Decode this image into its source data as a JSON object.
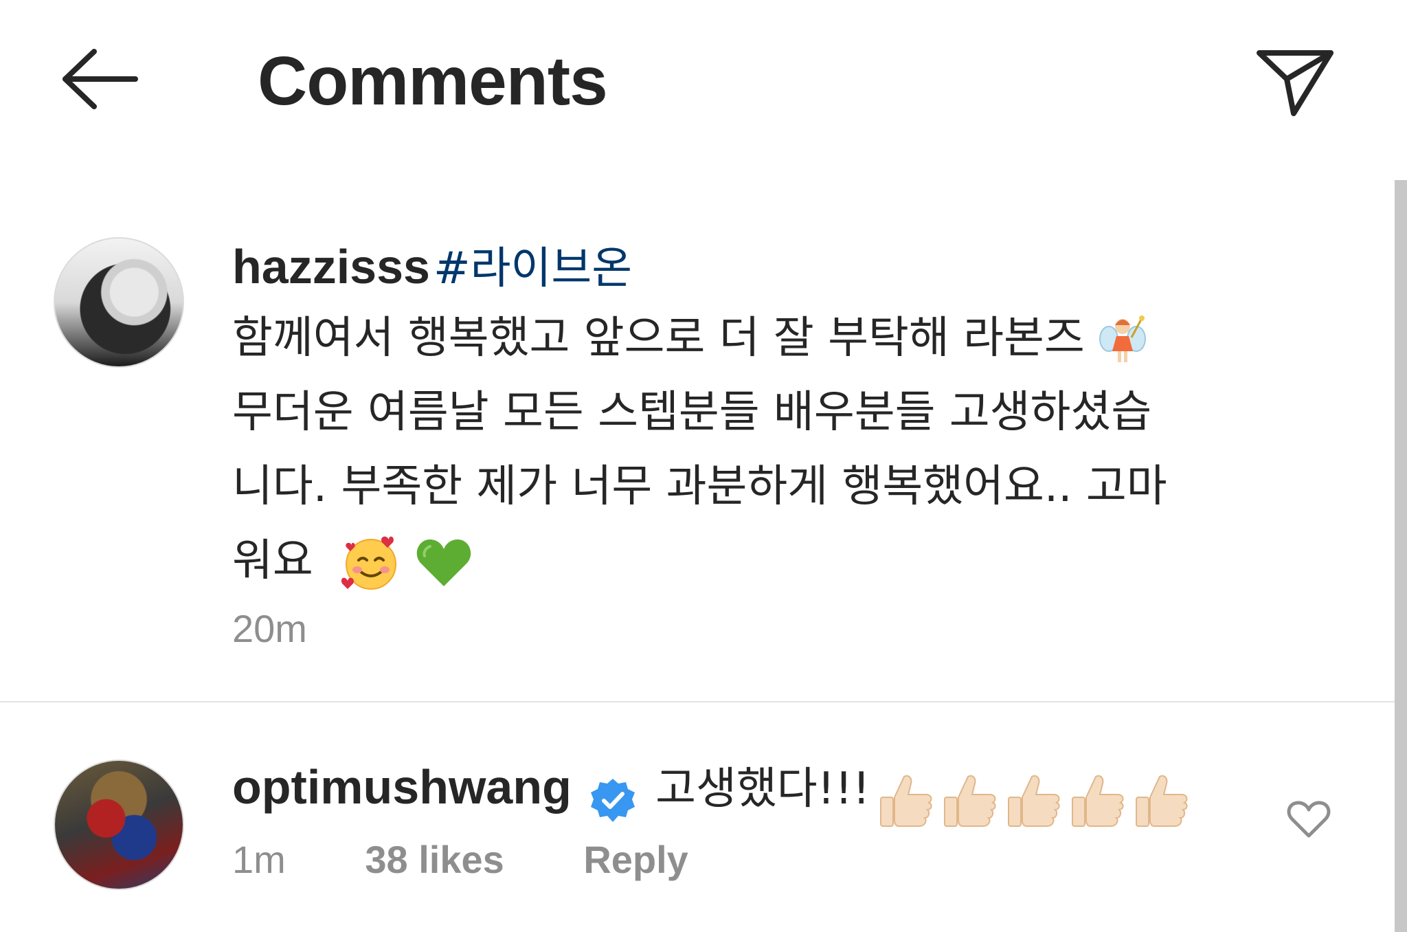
{
  "header": {
    "title": "Comments",
    "back_icon": "back-arrow-icon",
    "send_icon": "paper-plane-icon"
  },
  "comments": [
    {
      "username": "hazzisss",
      "hashtag": "#라이브온",
      "lines": [
        "함께여서 행복했고 앞으로 더 잘 부탁해 라본즈",
        "무더운 여름날 모든 스텝분들 배우분들 고생하셨습",
        "니다. 부족한 제가 너무 과분하게 행복했어요.. 고마",
        "워요"
      ],
      "emojis": [
        "fairy-emoji",
        "smiling-face-with-hearts-emoji",
        "green-heart-emoji"
      ],
      "timestamp": "20m"
    },
    {
      "username": "optimushwang",
      "verified": true,
      "text": "고생했다!!!",
      "emojis": [
        "thumbs-up-emoji",
        "thumbs-up-emoji",
        "thumbs-up-emoji",
        "thumbs-up-emoji",
        "thumbs-up-emoji"
      ],
      "time": "1m",
      "likes": "38 likes",
      "reply_label": "Reply"
    }
  ],
  "colors": {
    "text": "#262626",
    "secondary": "#8e8e8e",
    "hashtag": "#00376b",
    "verified": "#3897f0",
    "divider": "#e3e3e3"
  }
}
